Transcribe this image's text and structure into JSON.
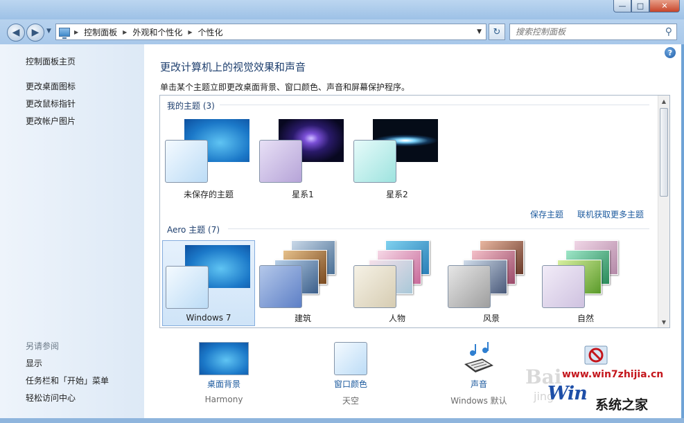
{
  "navbar": {
    "breadcrumb": [
      "控制面板",
      "外观和个性化",
      "个性化"
    ],
    "search_placeholder": "搜索控制面板"
  },
  "sidebar": {
    "items": [
      "控制面板主页",
      "更改桌面图标",
      "更改鼠标指针",
      "更改帐户图片"
    ],
    "see_also_label": "另请参阅",
    "see_also": [
      "显示",
      "任务栏和「开始」菜单",
      "轻松访问中心"
    ]
  },
  "main": {
    "title": "更改计算机上的视觉效果和声音",
    "description": "单击某个主题立即更改桌面背景、窗口颜色、声音和屏幕保护程序。",
    "my_themes_header": "我的主题 (3)",
    "my_themes": [
      "未保存的主题",
      "星系1",
      "星系2"
    ],
    "save_theme_link": "保存主题",
    "get_more_link": "联机获取更多主题",
    "aero_header": "Aero 主题 (7)",
    "aero_themes": [
      "Windows 7",
      "建筑",
      "人物",
      "风景",
      "自然"
    ]
  },
  "settings": [
    {
      "name": "桌面背景",
      "value": "Harmony"
    },
    {
      "name": "窗口颜色",
      "value": "天空"
    },
    {
      "name": "声音",
      "value": "Windows 默认"
    }
  ],
  "watermark": {
    "url": "www.win7zhijia.cn",
    "logo": "Win",
    "brand": "系统之家",
    "baidu": "Bai",
    "jingyan": "jing"
  },
  "colors": {
    "title": "#1e3f6e",
    "link": "#1c5a9e",
    "window_frame": "#a8c8ea",
    "close_button": "#c7452a"
  }
}
